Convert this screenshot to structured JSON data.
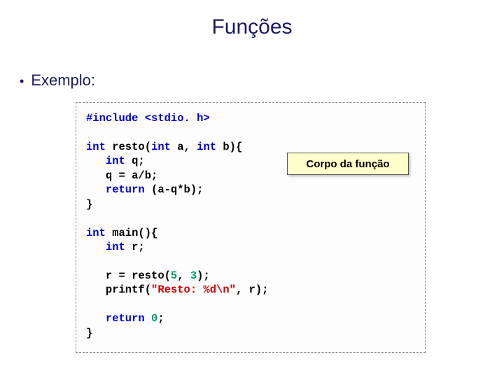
{
  "title": "Funções",
  "bullet": "Exemplo:",
  "callout": "Corpo da função",
  "code": {
    "include_kw": "#include ",
    "include_hdr": "<stdio. h>",
    "int": "int",
    "return": "return",
    "fn_resto_sig_a": " resto(",
    "fn_resto_sig_b": " a, ",
    "fn_resto_sig_c": " b){",
    "q_decl": " q;",
    "q_assign": "   q = a/b;",
    "ret_expr": " (a-q*b);",
    "brace_close": "}",
    "main_sig": " main(){",
    "r_decl": " r;",
    "call_a": "   r = resto(",
    "num5": "5",
    "comma": ", ",
    "num3": "3",
    "call_b": ");",
    "printf_a": "   printf(",
    "printf_str": "\"Resto: %d\\n\"",
    "printf_b": ", r);",
    "ret0_a": "   ",
    "num0": "0",
    "ret0_b": ";"
  }
}
